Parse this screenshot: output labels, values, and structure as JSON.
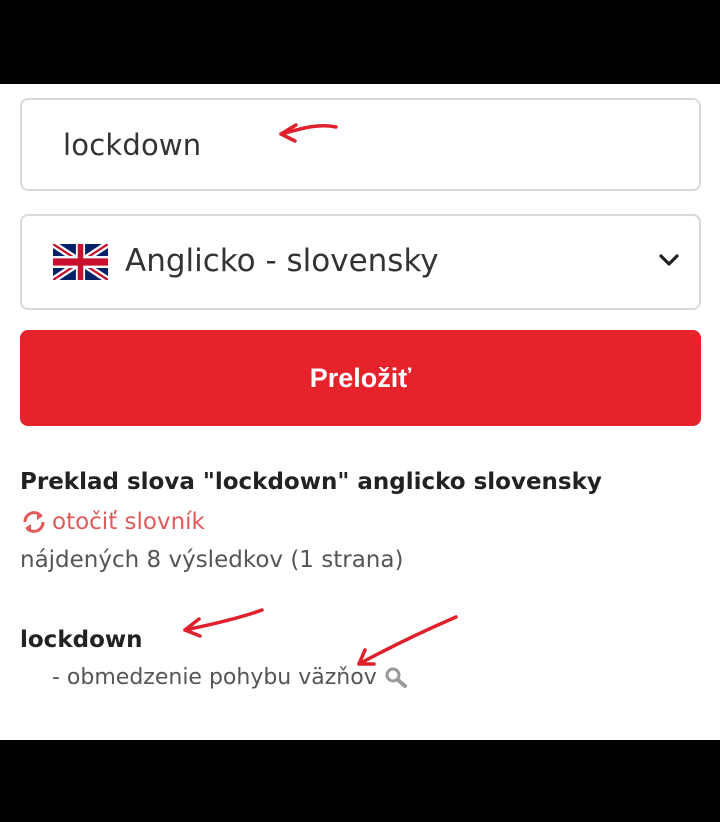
{
  "search": {
    "value": "lockdown"
  },
  "language_select": {
    "selected": "Anglicko - slovensky",
    "flag": "uk-flag-icon"
  },
  "translate_button": {
    "label": "Preložiť"
  },
  "results": {
    "title": "Preklad slova \"lockdown\" anglicko slovensky",
    "swap_label": "otočiť slovník",
    "count": "nájdených 8 výsledkov (1 strana)",
    "entries": [
      {
        "word": "lockdown",
        "definition": "- obmedzenie pohybu väzňov"
      }
    ]
  },
  "colors": {
    "accent": "#e6222b",
    "link": "#e05a5a",
    "annotation": "#e0202a"
  }
}
